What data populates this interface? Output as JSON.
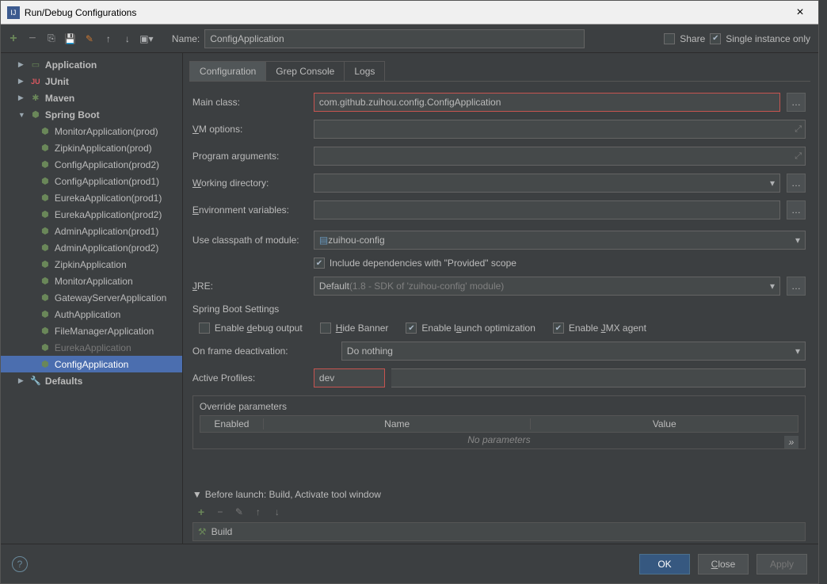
{
  "window": {
    "title": "Run/Debug Configurations"
  },
  "toprow": {
    "nameLabel": "Name:",
    "nameValue": "ConfigApplication",
    "share": "Share",
    "single": "Single instance only"
  },
  "tree": {
    "application": "Application",
    "junit": "JUnit",
    "maven": "Maven",
    "spring": "Spring Boot",
    "items": [
      "MonitorApplication(prod)",
      "ZipkinApplication(prod)",
      "ConfigApplication(prod2)",
      "ConfigApplication(prod1)",
      "EurekaApplication(prod1)",
      "EurekaApplication(prod2)",
      "AdminApplication(prod1)",
      "AdminApplication(prod2)",
      "ZipkinApplication",
      "MonitorApplication",
      "GatewayServerApplication",
      "AuthApplication",
      "FileManagerApplication",
      "EurekaApplication",
      "ConfigApplication"
    ],
    "defaults": "Defaults"
  },
  "tabs": {
    "config": "Configuration",
    "grep": "Grep Console",
    "logs": "Logs"
  },
  "form": {
    "mainClassLabel": "Main class:",
    "mainClassValue": "com.github.zuihou.config.ConfigApplication",
    "vmOptions": "VM options:",
    "progArgs": "Program arguments:",
    "workDir": "Working directory:",
    "envVars": "Environment variables:",
    "useCp": "Use classpath of module:",
    "moduleValue": "zuihou-config",
    "includeProvided": "Include dependencies with \"Provided\" scope",
    "jre": "JRE:",
    "jreDefault": "Default ",
    "jreHint": "(1.8 - SDK of 'zuihou-config' module)",
    "springSettings": "Spring Boot Settings",
    "enableDebug": "Enable debug output",
    "hideBanner": "Hide Banner",
    "enableLaunch": "Enable launch optimization",
    "enableJmx": "Enable JMX agent",
    "onFrame": "On frame deactivation:",
    "onFrameValue": "Do nothing",
    "activeProfiles": "Active Profiles:",
    "activeProfilesValue": "dev",
    "override": {
      "title": "Override parameters",
      "enabled": "Enabled",
      "name": "Name",
      "value": "Value",
      "empty": "No parameters"
    }
  },
  "beforeLaunch": {
    "title": "Before launch: Build, Activate tool window",
    "build": "Build"
  },
  "footer": {
    "ok": "OK",
    "close": "Close",
    "apply": "Apply"
  }
}
